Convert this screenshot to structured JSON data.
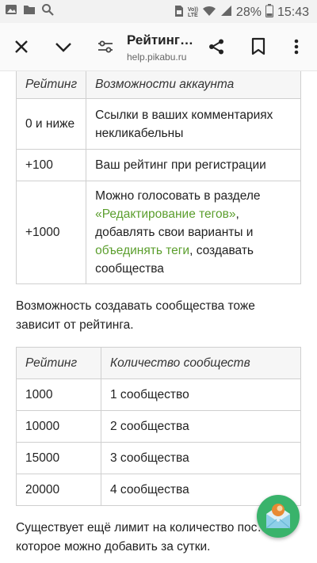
{
  "statusbar": {
    "volte_line1": "Vo))",
    "volte_line2": "LTE",
    "battery": "28%",
    "time": "15:43",
    "icons": [
      "image-icon",
      "folder-icon",
      "search-icon",
      "sim-icon",
      "volte-icon",
      "wifi-icon",
      "signal-icon",
      "battery-icon"
    ]
  },
  "toolbar": {
    "title": "Рейтинг…",
    "url": "help.pikabu.ru",
    "icons": [
      "close-icon",
      "chevron-down-icon",
      "page-settings-icon",
      "share-icon",
      "bookmark-icon",
      "more-icon"
    ]
  },
  "table1": {
    "headers": [
      "Рейтинг",
      "Возможности аккаунта"
    ],
    "rows": [
      {
        "rating": "0 и ниже",
        "desc": "Ссылки в ваших комментариях некликабельны"
      },
      {
        "rating": "+100",
        "desc": "Ваш рейтинг при регистрации"
      },
      {
        "rating": "+1000",
        "desc_a": "Можно голосовать в разделе ",
        "link1": "«Редактирование тегов»",
        "desc_b": ", добавлять свои варианты и ",
        "link2": "объединять теги",
        "desc_c": ", создавать сообщества"
      }
    ]
  },
  "paragraph1": "Возможность создавать сообщества тоже зависит от рейтинга.",
  "table2": {
    "headers": [
      "Рейтинг",
      "Количество сообществ"
    ],
    "rows": [
      {
        "rating": "1000",
        "count": "1 сообщество"
      },
      {
        "rating": "10000",
        "count": "2 сообщества"
      },
      {
        "rating": "15000",
        "count": "3 сообщества"
      },
      {
        "rating": "20000",
        "count": "4 сообщества"
      }
    ]
  },
  "paragraph2": "Существует ещё лимит на количество пос… которое можно добавить за сутки.",
  "fab": {
    "icon": "mail-icon"
  },
  "colors": {
    "link": "#5b9e2d",
    "fab": "#39b36b"
  }
}
